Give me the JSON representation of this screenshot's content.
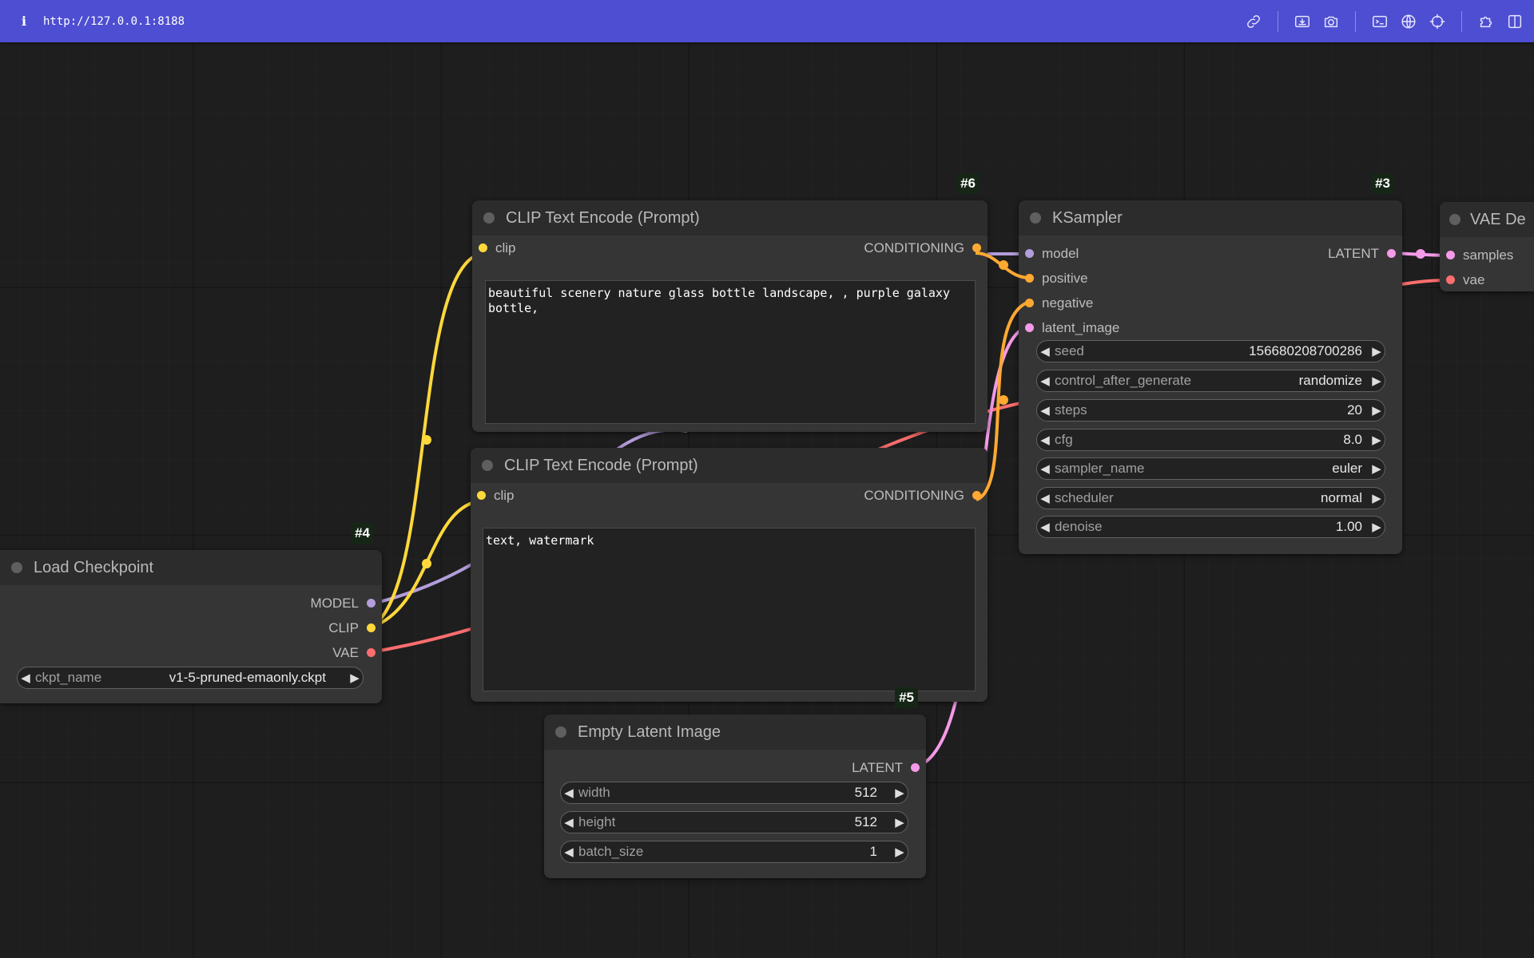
{
  "topbar": {
    "url": "http://127.0.0.1:8188",
    "info_glyph": "i",
    "icons": [
      "link-icon",
      "image-download-icon",
      "camera-icon",
      "terminal-icon",
      "globe-icon",
      "crosshair-icon",
      "puzzle-icon",
      "panel-icon"
    ]
  },
  "nodes": {
    "positive": {
      "id": "#6",
      "title": "CLIP Text Encode (Prompt)",
      "input_clip": "clip",
      "output": "CONDITIONING",
      "text": "beautiful scenery nature glass bottle landscape, , purple galaxy bottle,"
    },
    "negative": {
      "title": "CLIP Text Encode (Prompt)",
      "input_clip": "clip",
      "output": "CONDITIONING",
      "text": "text, watermark"
    },
    "ksampler": {
      "id": "#3",
      "title": "KSampler",
      "inputs": [
        "model",
        "positive",
        "negative",
        "latent_image"
      ],
      "output": "LATENT",
      "widgets": [
        {
          "label": "seed",
          "value": "156680208700286"
        },
        {
          "label": "control_after_generate",
          "value": "randomize"
        },
        {
          "label": "steps",
          "value": "20"
        },
        {
          "label": "cfg",
          "value": "8.0"
        },
        {
          "label": "sampler_name",
          "value": "euler"
        },
        {
          "label": "scheduler",
          "value": "normal"
        },
        {
          "label": "denoise",
          "value": "1.00"
        }
      ]
    },
    "vae_decode": {
      "title": "VAE De",
      "inputs": [
        "samples",
        "vae"
      ]
    },
    "checkpoint": {
      "id": "#4",
      "title": "Load Checkpoint",
      "outputs": [
        "MODEL",
        "CLIP",
        "VAE"
      ],
      "widget": {
        "label": "ckpt_name",
        "value": "v1-5-pruned-emaonly.ckpt"
      }
    },
    "latent": {
      "id": "#5",
      "title": "Empty Latent Image",
      "output": "LATENT",
      "widgets": [
        {
          "label": "width",
          "value": "512"
        },
        {
          "label": "height",
          "value": "512"
        },
        {
          "label": "batch_size",
          "value": "1"
        }
      ]
    }
  },
  "colors": {
    "clip": "#ffd83c",
    "conditioning": "#ffa931",
    "model": "#b39ddb",
    "latent": "#f59ae9",
    "vae": "#ff6e6e",
    "topbar": "#4e4ed2",
    "canvas": "#1e1e1e"
  }
}
